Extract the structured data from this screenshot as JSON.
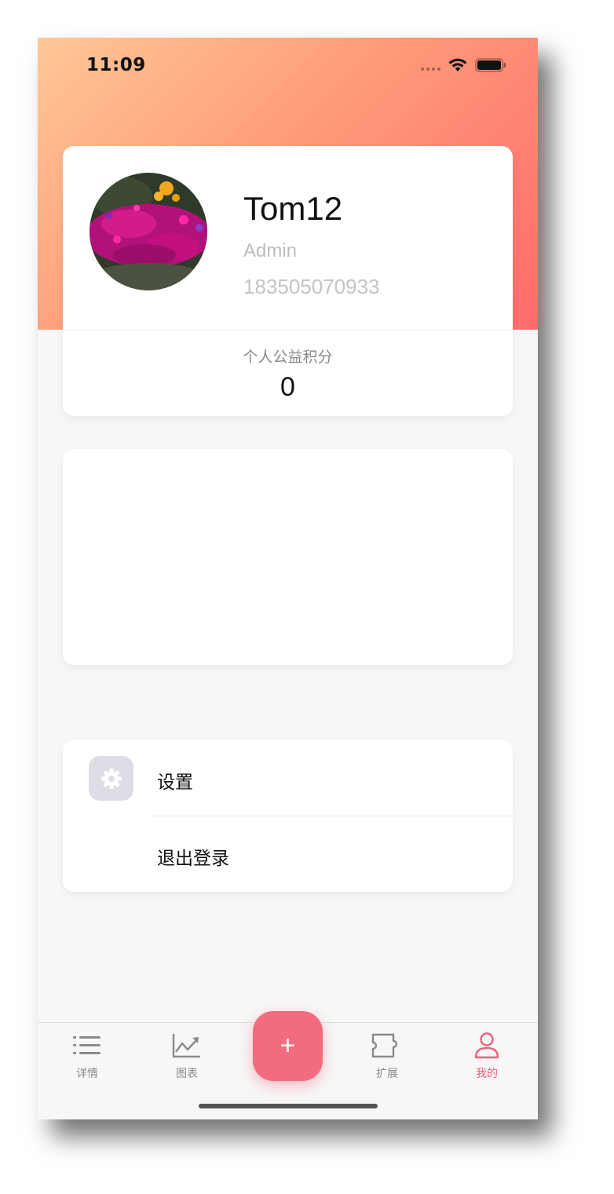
{
  "status_bar": {
    "time": "11:09"
  },
  "profile": {
    "name": "Tom12",
    "role": "Admin",
    "phone": "183505070933",
    "points_label": "个人公益积分",
    "points_value": "0"
  },
  "menu": {
    "items": [
      {
        "label": "设置",
        "icon": "gear-icon"
      },
      {
        "label": "退出登录"
      }
    ]
  },
  "tabbar": {
    "items": [
      {
        "label": "详情",
        "icon": "list-icon"
      },
      {
        "label": "图表",
        "icon": "chart-icon"
      },
      {
        "label": "扩展",
        "icon": "puzzle-icon"
      },
      {
        "label": "我的",
        "icon": "user-icon",
        "active": true
      }
    ],
    "fab_symbol": "+"
  },
  "colors": {
    "accent": "#f36b7f",
    "hero_start": "#ffc796",
    "hero_end": "#ff6b6b",
    "active_tab": "#f0607a"
  }
}
